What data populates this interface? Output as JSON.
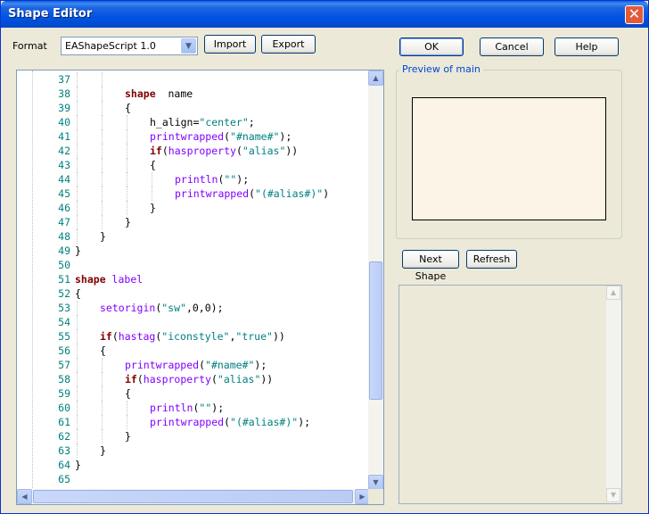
{
  "window": {
    "title": "Shape Editor"
  },
  "toolbar": {
    "format_label": "Format",
    "format_value": "EAShapeScript 1.0",
    "import_label": "Import",
    "export_label": "Export"
  },
  "dialog_buttons": {
    "ok": "OK",
    "cancel": "Cancel",
    "help": "Help"
  },
  "preview": {
    "group_label": "Preview of main"
  },
  "shape_buttons": {
    "next_shape": "Next Shape",
    "refresh": "Refresh"
  },
  "editor": {
    "lines": [
      {
        "n": "37",
        "indent": 2,
        "tokens": []
      },
      {
        "n": "38",
        "indent": 2,
        "tokens": [
          [
            "kw",
            "shape"
          ],
          [
            "",
            "  name"
          ]
        ]
      },
      {
        "n": "39",
        "indent": 2,
        "tokens": [
          [
            "",
            "{"
          ]
        ]
      },
      {
        "n": "40",
        "indent": 3,
        "tokens": [
          [
            "",
            "h_align="
          ],
          [
            "str",
            "\"center\""
          ],
          [
            "",
            ";"
          ]
        ]
      },
      {
        "n": "41",
        "indent": 3,
        "tokens": [
          [
            "fn",
            "printwrapped"
          ],
          [
            "",
            "("
          ],
          [
            "str",
            "\"#name#\""
          ],
          [
            "",
            ");"
          ]
        ]
      },
      {
        "n": "42",
        "indent": 3,
        "tokens": [
          [
            "kw",
            "if"
          ],
          [
            "",
            "("
          ],
          [
            "fn",
            "hasproperty"
          ],
          [
            "",
            "("
          ],
          [
            "str",
            "\"alias\""
          ],
          [
            "",
            "))"
          ]
        ]
      },
      {
        "n": "43",
        "indent": 3,
        "tokens": [
          [
            "",
            "{"
          ]
        ]
      },
      {
        "n": "44",
        "indent": 4,
        "tokens": [
          [
            "fn",
            "println"
          ],
          [
            "",
            "("
          ],
          [
            "str",
            "\"\""
          ],
          [
            "",
            ");"
          ]
        ]
      },
      {
        "n": "45",
        "indent": 4,
        "tokens": [
          [
            "fn",
            "printwrapped"
          ],
          [
            "",
            "("
          ],
          [
            "str",
            "\"(#alias#)\""
          ],
          [
            "",
            ")"
          ]
        ]
      },
      {
        "n": "46",
        "indent": 3,
        "tokens": [
          [
            "",
            "}"
          ]
        ]
      },
      {
        "n": "47",
        "indent": 2,
        "tokens": [
          [
            "",
            "}"
          ]
        ]
      },
      {
        "n": "48",
        "indent": 1,
        "tokens": [
          [
            "",
            "}"
          ]
        ]
      },
      {
        "n": "49",
        "indent": 0,
        "tokens": [
          [
            "",
            "}"
          ]
        ]
      },
      {
        "n": "50",
        "indent": 0,
        "tokens": []
      },
      {
        "n": "51",
        "indent": 0,
        "tokens": [
          [
            "kw",
            "shape"
          ],
          [
            "fn",
            " label"
          ]
        ]
      },
      {
        "n": "52",
        "indent": 0,
        "tokens": [
          [
            "",
            "{"
          ]
        ]
      },
      {
        "n": "53",
        "indent": 1,
        "tokens": [
          [
            "fn",
            "setorigin"
          ],
          [
            "",
            "("
          ],
          [
            "str",
            "\"sw\""
          ],
          [
            "",
            ",0,0);"
          ]
        ]
      },
      {
        "n": "54",
        "indent": 1,
        "tokens": []
      },
      {
        "n": "55",
        "indent": 1,
        "tokens": [
          [
            "kw",
            "if"
          ],
          [
            "",
            "("
          ],
          [
            "fn",
            "hastag"
          ],
          [
            "",
            "("
          ],
          [
            "str",
            "\"iconstyle\""
          ],
          [
            "",
            ","
          ],
          [
            "str",
            "\"true\""
          ],
          [
            "",
            "))"
          ]
        ]
      },
      {
        "n": "56",
        "indent": 1,
        "tokens": [
          [
            "",
            "{"
          ]
        ]
      },
      {
        "n": "57",
        "indent": 2,
        "tokens": [
          [
            "fn",
            "printwrapped"
          ],
          [
            "",
            "("
          ],
          [
            "str",
            "\"#name#\""
          ],
          [
            "",
            ");"
          ]
        ]
      },
      {
        "n": "58",
        "indent": 2,
        "tokens": [
          [
            "kw",
            "if"
          ],
          [
            "",
            "("
          ],
          [
            "fn",
            "hasproperty"
          ],
          [
            "",
            "("
          ],
          [
            "str",
            "\"alias\""
          ],
          [
            "",
            "))"
          ]
        ]
      },
      {
        "n": "59",
        "indent": 2,
        "tokens": [
          [
            "",
            "{"
          ]
        ]
      },
      {
        "n": "60",
        "indent": 3,
        "tokens": [
          [
            "fn",
            "println"
          ],
          [
            "",
            "("
          ],
          [
            "str",
            "\"\""
          ],
          [
            "",
            ");"
          ]
        ]
      },
      {
        "n": "61",
        "indent": 3,
        "tokens": [
          [
            "fn",
            "printwrapped"
          ],
          [
            "",
            "("
          ],
          [
            "str",
            "\"(#alias#)\""
          ],
          [
            "",
            ");"
          ]
        ]
      },
      {
        "n": "62",
        "indent": 2,
        "tokens": [
          [
            "",
            "}"
          ]
        ]
      },
      {
        "n": "63",
        "indent": 1,
        "tokens": [
          [
            "",
            "}"
          ]
        ]
      },
      {
        "n": "64",
        "indent": 0,
        "tokens": [
          [
            "",
            "}"
          ]
        ]
      },
      {
        "n": "65",
        "indent": 0,
        "tokens": []
      }
    ]
  },
  "icons": {
    "close": "close-icon",
    "combo_arrow": "chevron-down-icon",
    "scroll_up": "scroll-up-arrow-icon",
    "scroll_down": "scroll-down-arrow-icon",
    "scroll_left": "scroll-left-arrow-icon",
    "scroll_right": "scroll-right-arrow-icon"
  },
  "colors": {
    "title_bar": "#0054E3",
    "keyword": "#800000",
    "function": "#8000FF",
    "string": "#008080",
    "line_number": "#008080",
    "preview_fill": "#FCF4E6",
    "group_label": "#0046D5"
  }
}
